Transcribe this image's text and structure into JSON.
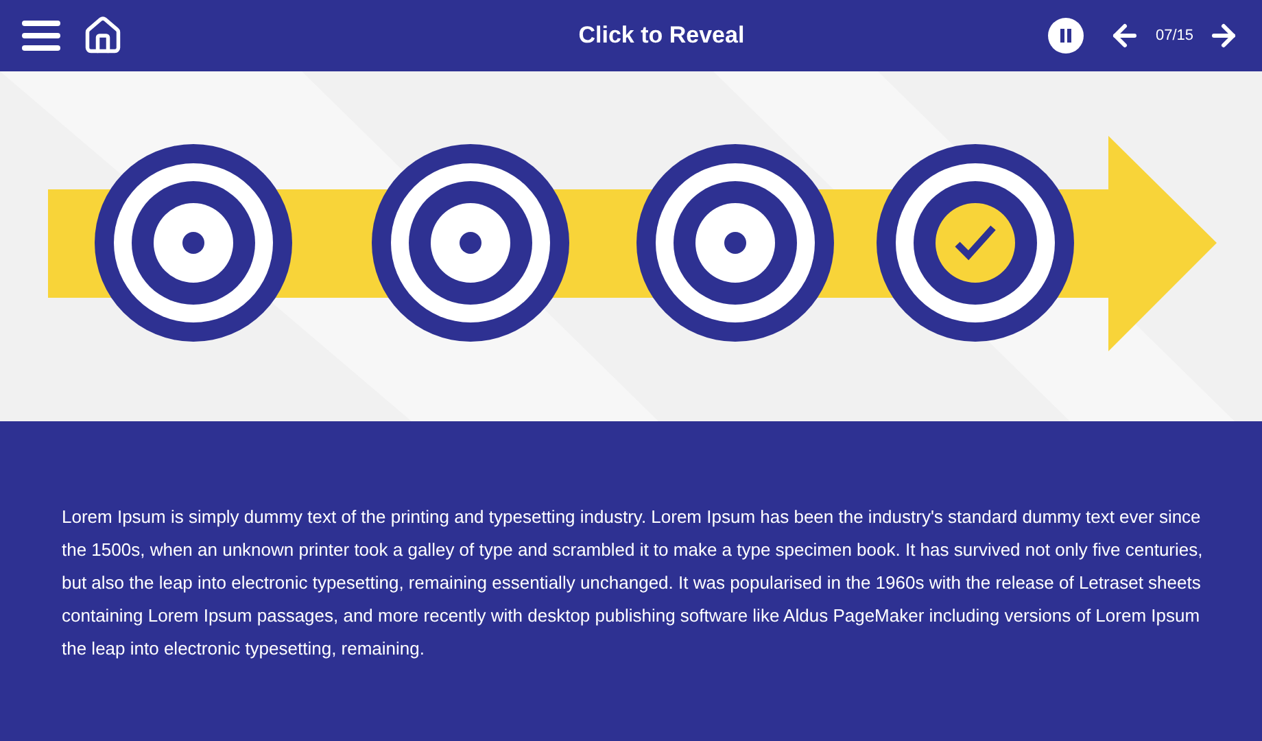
{
  "header": {
    "title": "Click to Reveal",
    "counter": "07/15"
  },
  "targets": [
    {
      "revealed": false
    },
    {
      "revealed": false
    },
    {
      "revealed": false
    },
    {
      "revealed": true
    }
  ],
  "body": {
    "text": "Lorem Ipsum is simply dummy text of the printing and typesetting industry. Lorem Ipsum has been the industry's standard dummy text ever since the 1500s, when an unknown printer took a galley of type and scrambled it to make a type specimen book. It has survived not only five centuries, but also the leap into electronic typesetting, remaining essentially unchanged. It was popularised in the 1960s with the release of Letraset sheets containing Lorem Ipsum passages, and more recently with desktop publishing software like Aldus PageMaker including versions of Lorem Ipsum the leap into electronic typesetting, remaining."
  }
}
